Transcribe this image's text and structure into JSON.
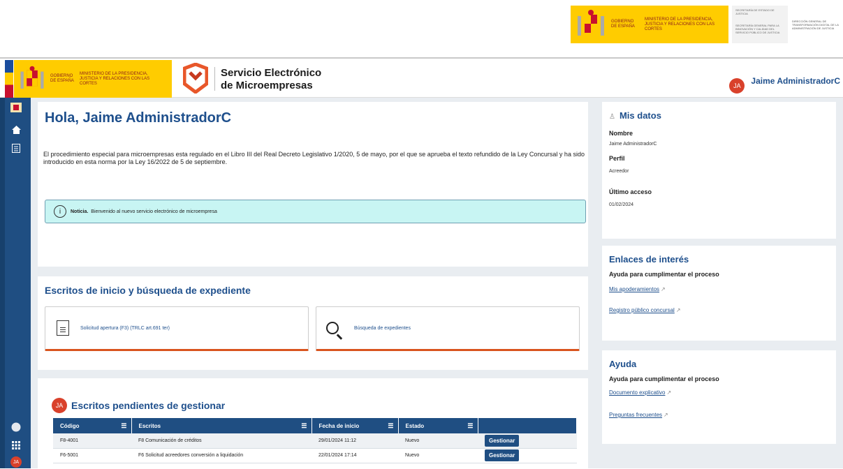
{
  "top_strip": {
    "gobierno": "GOBIERNO DE ESPAÑA",
    "ministerio": "MINISTERIO DE LA PRESIDENCIA, JUSTICIA Y RELACIONES CON LAS CORTES",
    "secretaria_estado": "SECRETARÍA DE ESTADO DE JUSTICIA",
    "secretaria_general": "SECRETARÍA GENERAL PARA LA INNOVACIÓN Y CALIDAD DEL SERVICIO PÚBLICO DE JUSTICIA",
    "direccion_general": "DIRECCIÓN GENERAL DE TRANSFORMACIÓN DIGITAL DE LA ADMINISTRACIÓN DE JUSTICIA"
  },
  "header": {
    "gobierno": "GOBIERNO DE ESPAÑA",
    "ministerio": "MINISTERIO DE LA PRESIDENCIA, JUSTICIA Y RELACIONES CON LAS CORTES",
    "app_title_1": "Servicio Electrónico",
    "app_title_2": "de Microempresas",
    "user_initials": "JA",
    "user_name": "Jaime AdministradorC"
  },
  "welcome": {
    "title": "Hola, Jaime AdministradorC",
    "intro": "El procedimiento especial para microempresas esta regulado en el Libro III del Real Decreto Legislativo 1/2020, 5 de mayo, por el que se aprueba el texto refundido de la Ley Concursal y ha sido introducido en esta norma por la Ley 16/2022 de 5 de septiembre.",
    "notice_label": "Noticia.",
    "notice_text": "Bienvenido al nuevo servicio electrónico de microempresa"
  },
  "escritos_inicio": {
    "title": "Escritos de inicio y búsqueda de expediente",
    "tile1_label": "Solicitud apertura (F3) (TRLC art.691 ter)",
    "tile2_label": "Búsqueda de expedientes"
  },
  "pendientes": {
    "avatar": "JA",
    "title": "Escritos pendientes de gestionar",
    "columns": [
      "Código",
      "Escritos",
      "Fecha de inicio",
      "Estado"
    ],
    "rows": [
      {
        "codigo": "F8-4001",
        "escrito": "F8 Comunicación de créditos",
        "fecha": "29/01/2024 11:12",
        "estado": "Nuevo",
        "action": "Gestionar"
      },
      {
        "codigo": "F6-5001",
        "escrito": "F6 Solicitud acreedores conversión a liquidación",
        "fecha": "22/01/2024 17:14",
        "estado": "Nuevo",
        "action": "Gestionar"
      }
    ]
  },
  "mis_datos": {
    "title": "Mis datos",
    "nombre_label": "Nombre",
    "nombre_val": "Jaime AdministradorC",
    "perfil_label": "Perfil",
    "perfil_val": "Acreedor",
    "acceso_label": "Último acceso",
    "acceso_val": "01/02/2024"
  },
  "enlaces": {
    "title": "Enlaces de interés",
    "subtitle": "Ayuda para cumplimentar el proceso",
    "link1": "Mis apoderamientos",
    "link2": "Registro público concursal"
  },
  "ayuda": {
    "title": "Ayuda",
    "subtitle": "Ayuda para cumplimentar el proceso",
    "link1": "Documento explicativo",
    "link2": "Preguntas frecuentes"
  },
  "sidebar": {
    "avatar": "JA"
  },
  "colors": {
    "primary": "#1f4e82",
    "accent": "#d9541e",
    "notice_bg": "#c8f5f3",
    "gob_yellow": "#ffcc00"
  }
}
